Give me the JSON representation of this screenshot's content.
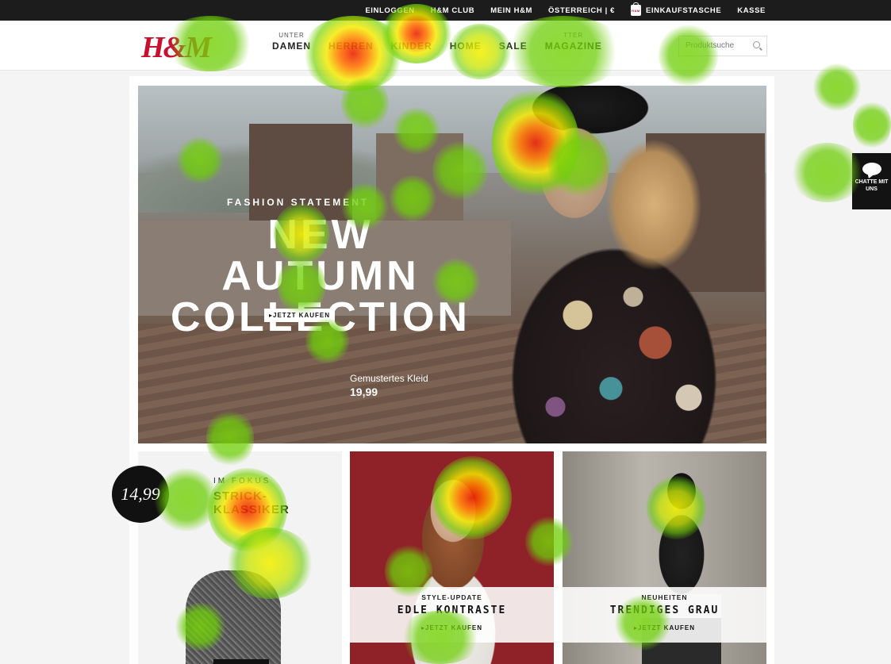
{
  "topbar": {
    "links": [
      "EINLOGGEN",
      "H&M CLUB",
      "MEIN H&M",
      "ÖSTERREICH | €"
    ],
    "bag_label": "EINKAUFSTASCHE",
    "checkout_label": "KASSE"
  },
  "header": {
    "logo": "H&M",
    "nav": [
      {
        "sup": "UNTER",
        "label": "DAMEN"
      },
      {
        "sup": "",
        "label": "HERREN"
      },
      {
        "sup": "",
        "label": "KINDER"
      },
      {
        "sup": "",
        "label": "HOME"
      },
      {
        "sup": "",
        "label": "SALE"
      },
      {
        "sup": "TTER",
        "label": "MAGAZINE"
      }
    ],
    "search_placeholder": "Produktsuche"
  },
  "hero": {
    "eyebrow": "FASHION STATEMENT",
    "headline_line1": "NEW AUTUMN",
    "headline_line2": "COLLECTION",
    "cta": "JETZT KAUFEN",
    "product_name": "Gemustertes Kleid",
    "product_price": "19,99"
  },
  "tiles": [
    {
      "eyebrow": "IM FOKUS",
      "title": "STRICK-KLASSIKER",
      "price_badge": "14,99"
    },
    {
      "eyebrow": "STYLE-UPDATE",
      "title": "EDLE KONTRASTE",
      "cta": "JETZT KAUFEN"
    },
    {
      "eyebrow": "NEUHEITEN",
      "title": "TRENDIGES GRAU",
      "cta": "JETZT KAUFEN"
    }
  ],
  "chat": {
    "label": "CHATTE MIT UNS"
  },
  "icons": [
    "search-icon",
    "bag-icon",
    "chat-icon"
  ],
  "colors": {
    "brand": "#c8102e",
    "topbar": "#1c1c1c",
    "tile_red": "#8e2228"
  }
}
